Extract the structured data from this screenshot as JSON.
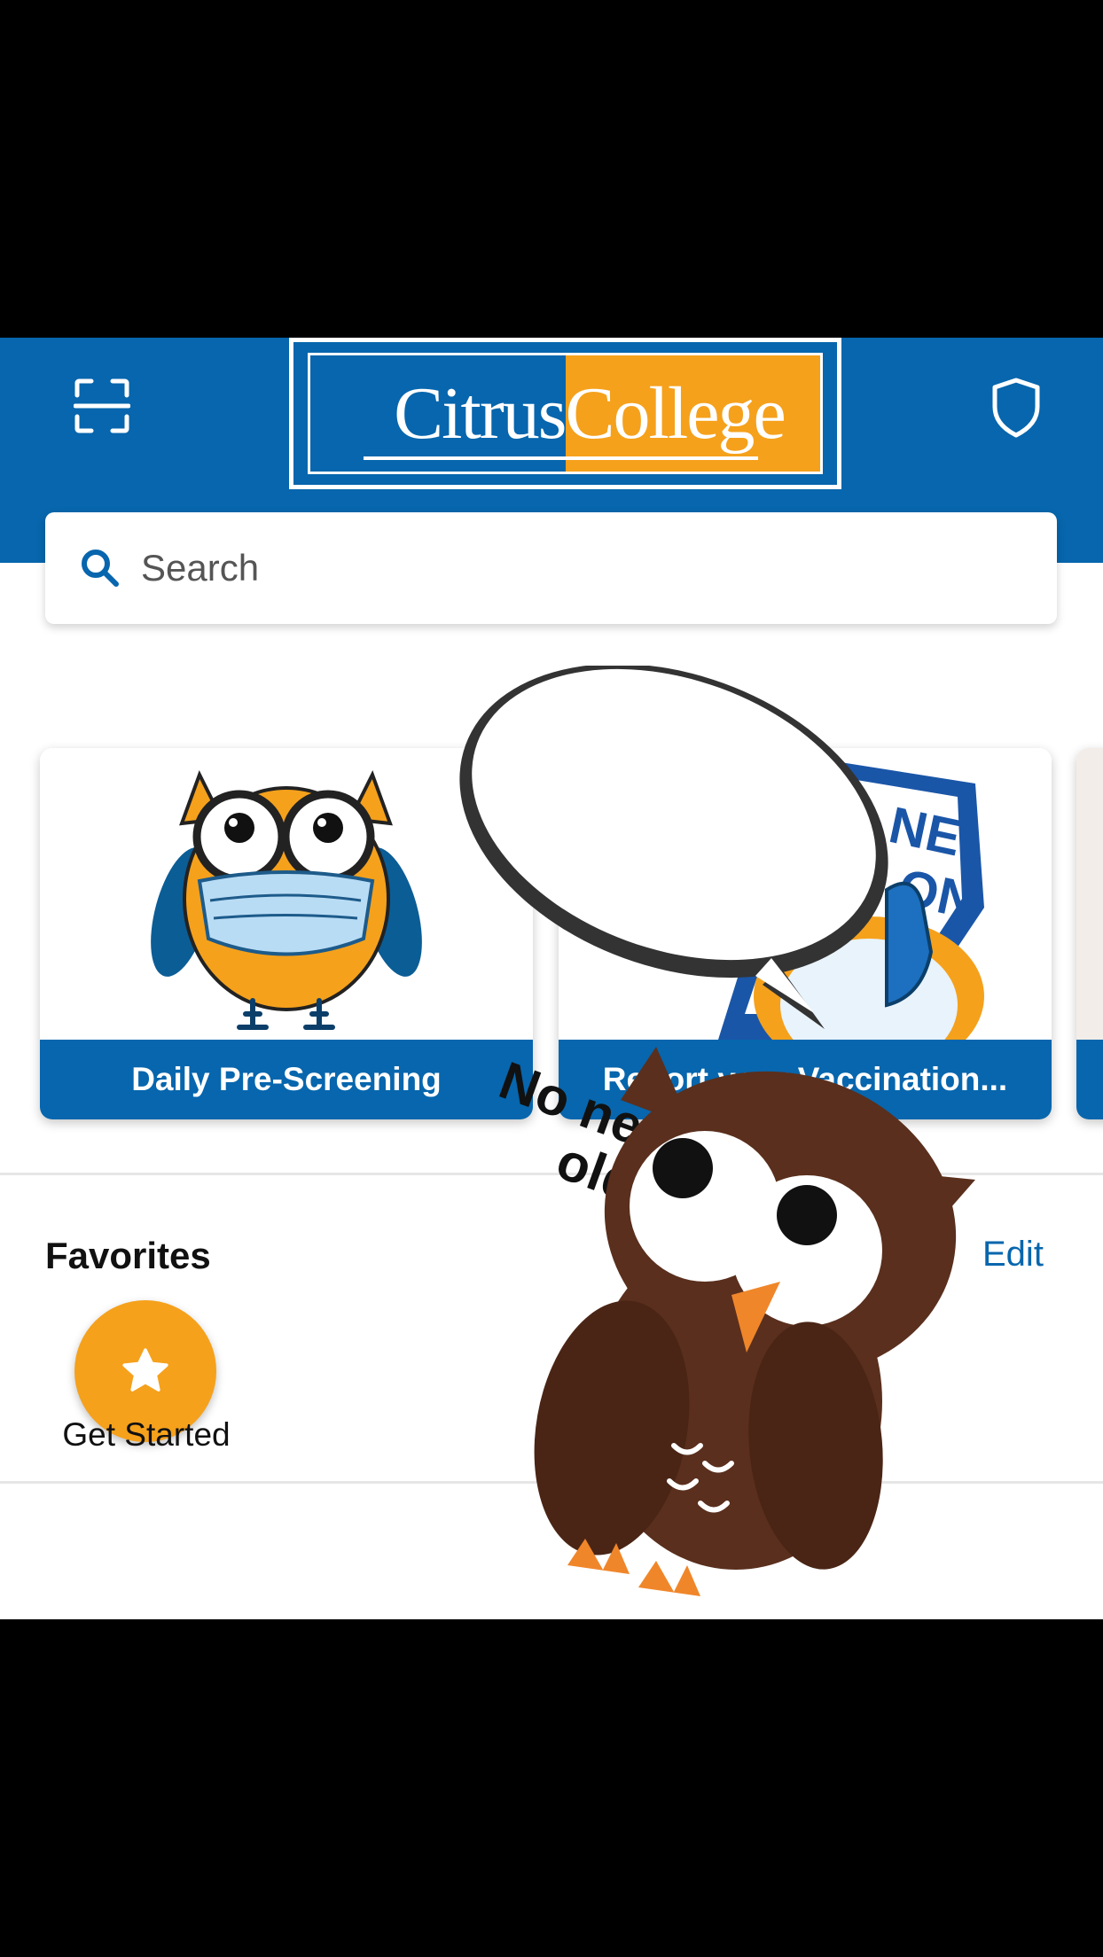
{
  "header": {
    "logo_left": "Citrus",
    "logo_right": "College"
  },
  "search": {
    "placeholder": "Search"
  },
  "cards": [
    {
      "label": "Daily Pre-Screening"
    },
    {
      "label": "Report your Vaccination..."
    }
  ],
  "favorites": {
    "title": "Favorites",
    "edit_label": "Edit",
    "items": [
      {
        "label": "Get Started",
        "icon": "star-icon"
      }
    ]
  },
  "sticker": {
    "speech": "No need for you old friend"
  },
  "colors": {
    "brand_blue": "#0766ad",
    "brand_orange": "#f5a11c"
  }
}
